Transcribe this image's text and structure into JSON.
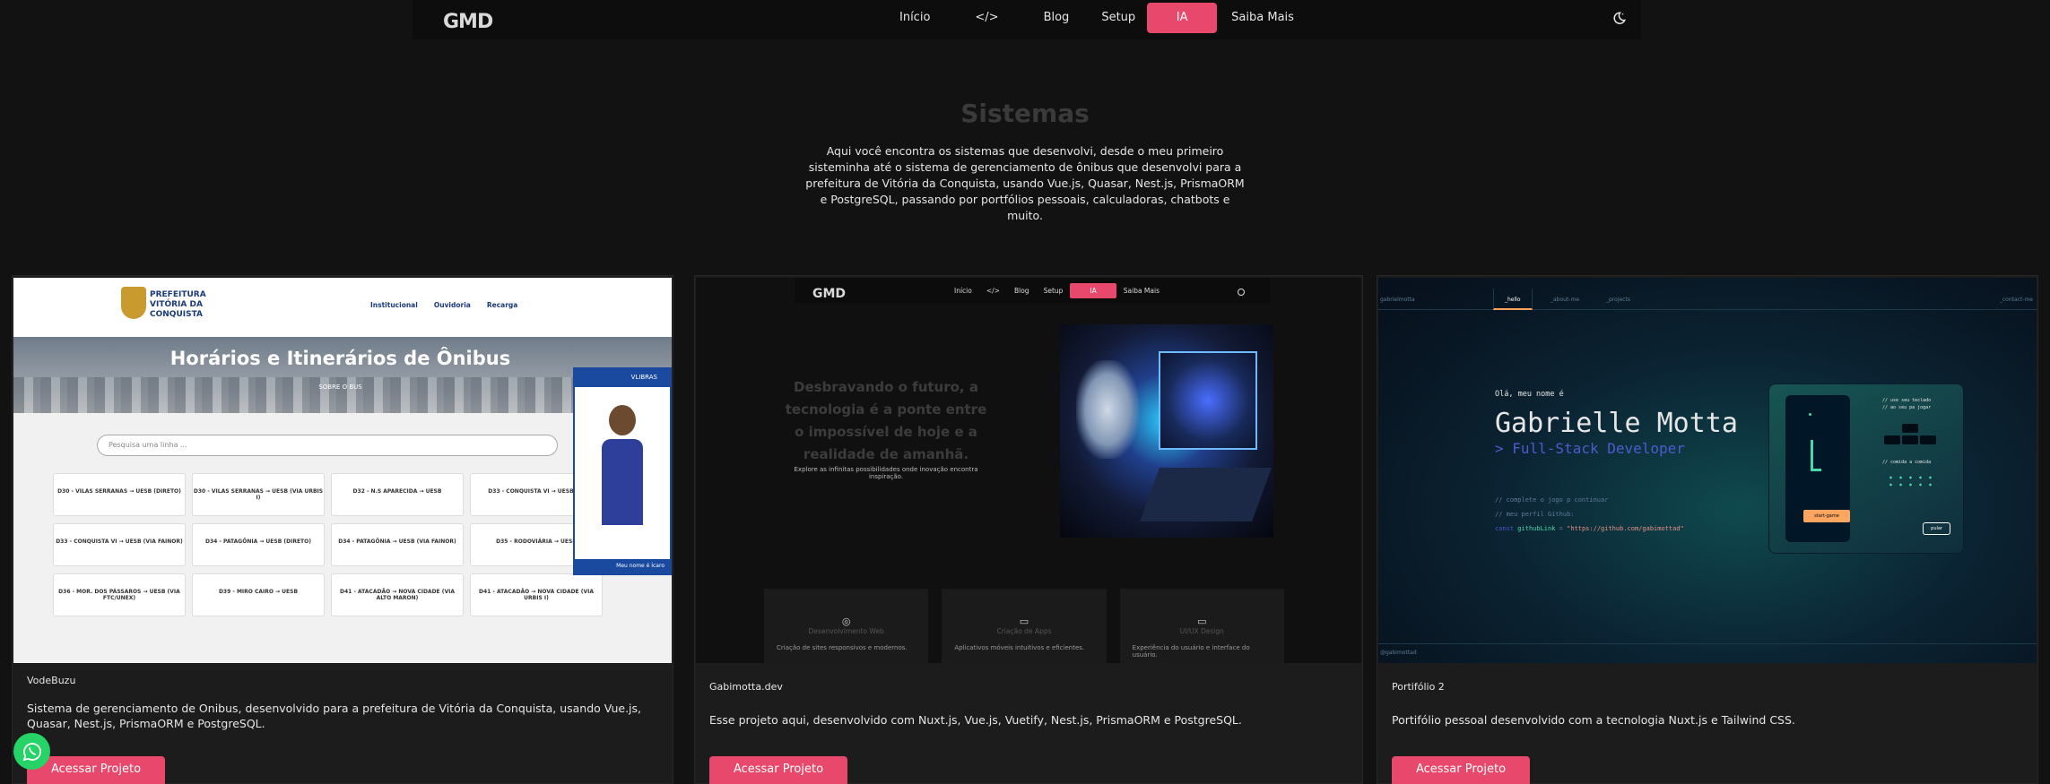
{
  "nav": {
    "logo": "GMD",
    "links": [
      "Início",
      "</>",
      "Blog",
      "Setup",
      "IA",
      "Saiba Mais"
    ],
    "active": "IA"
  },
  "hero": {
    "title": "Sistemas",
    "description": "Aqui você encontra os sistemas que desenvolvi, desde o meu primeiro sisteminha até o sistema de gerenciamento de ônibus que desenvolvi para a prefeitura de Vitória da Conquista, usando Vue.js, Quasar, Nest.js, PrismaORM e PostgreSQL, passando por portfólios pessoais, calculadoras, chatbots e muito."
  },
  "cards": [
    {
      "title": "VodeBuzu",
      "description": "Sistema de gerenciamento de Onibus, desenvolvido para a prefeitura de Vitória da Conquista, usando Vue.js, Quasar, Nest.js, PrismaORM e PostgreSQL.",
      "button": "Acessar Projeto",
      "thumb": {
        "brand": "PREFEITURA VITÓRIA DA CONQUISTA",
        "links": [
          "Institucional",
          "Ouvidoria",
          "Recarga"
        ],
        "heading": "Horários e Itinerários de Ônibus",
        "subheading": "SOBRE O BUS",
        "search_placeholder": "Pesquisa uma linha ...",
        "lines": [
          "D30 - VILAS SERRANAS → UESB (DIRETO)",
          "D30 - VILAS SERRANAS → UESB (VIA URBIS I)",
          "D32 - N.S APARECIDA → UESB",
          "D33 - CONQUISTA VI → UESB (DI",
          "D33 - CONQUISTA VI → UESB (VIA FAINOR)",
          "D34 - PATAGÔNIA → UESB (DIRETO)",
          "D34 - PATAGÔNIA → UESB (VIA FAINOR)",
          "D35 - RODOVIÁRIA → UESB",
          "D36 - MOR. DOS PÁSSAROS → UESB (VIA FTC/UNEX)",
          "D39 - MIRO CAIRO → UESB",
          "D41 - ATACADÃO → NOVA CIDADE (VIA ALTO MARON)",
          "D41 - ATACADÃO → NOVA CIDADE (VIA URBIS I)"
        ],
        "panel_label": "VLIBRAS",
        "panel_footer": "Meu nome é Ícaro"
      }
    },
    {
      "title": "Gabimotta.dev",
      "description": "Esse projeto aqui, desenvolvido com Nuxt.js, Vue.js, Vuetify, Nest.js, PrismaORM e PostgreSQL.",
      "button": "Acessar Projeto",
      "thumb": {
        "logo": "GMD",
        "links": [
          "Início",
          "</>",
          "Blog",
          "Setup",
          "IA",
          "Saiba Mais"
        ],
        "headline": "Desbravando o futuro, a tecnologia é a ponte entre o impossível de hoje e a realidade de amanhã.",
        "subline": "Explore as infinitas possibilidades onde inovação encontra inspiração.",
        "services": [
          {
            "title": "Desenvolvimento Web",
            "desc": "Criação de sites responsivos e modernos."
          },
          {
            "title": "Criação de Apps",
            "desc": "Aplicativos móveis intuitivos e eficientes."
          },
          {
            "title": "UI/UX Design",
            "desc": "Experiência do usuário e interface do usuário."
          }
        ]
      }
    },
    {
      "title": "Portifólio 2",
      "description": "Portifólio pessoal desenvolvido com a tecnologia Nuxt.js e Tailwind CSS.",
      "button": "Acessar Projeto",
      "thumb": {
        "brand": "gabrielmotta",
        "tabs": [
          "_hello",
          "_about-me",
          "_projects"
        ],
        "contact": "_contact-me",
        "greeting": "Olá, meu nome é",
        "name": "Gabrielle Motta",
        "role": "> Full-Stack Developer",
        "comment1": "// complete o jogo p continuar",
        "comment2": "// meu perfil Github:",
        "code_kw": "const",
        "code_var": "githubLink",
        "code_str": "\"https://github.com/gabimottad\"",
        "game_hint1": "// use seu teclado",
        "game_hint2": "// ao seu pa jogar",
        "game_food": "// comida a comida",
        "start": "start-game",
        "skip": "pular",
        "footer": "@gabimottad"
      }
    }
  ],
  "colors": {
    "accent": "#e8486b",
    "background": "#121212",
    "card": "#1c1c1c",
    "whatsapp": "#25d366"
  }
}
